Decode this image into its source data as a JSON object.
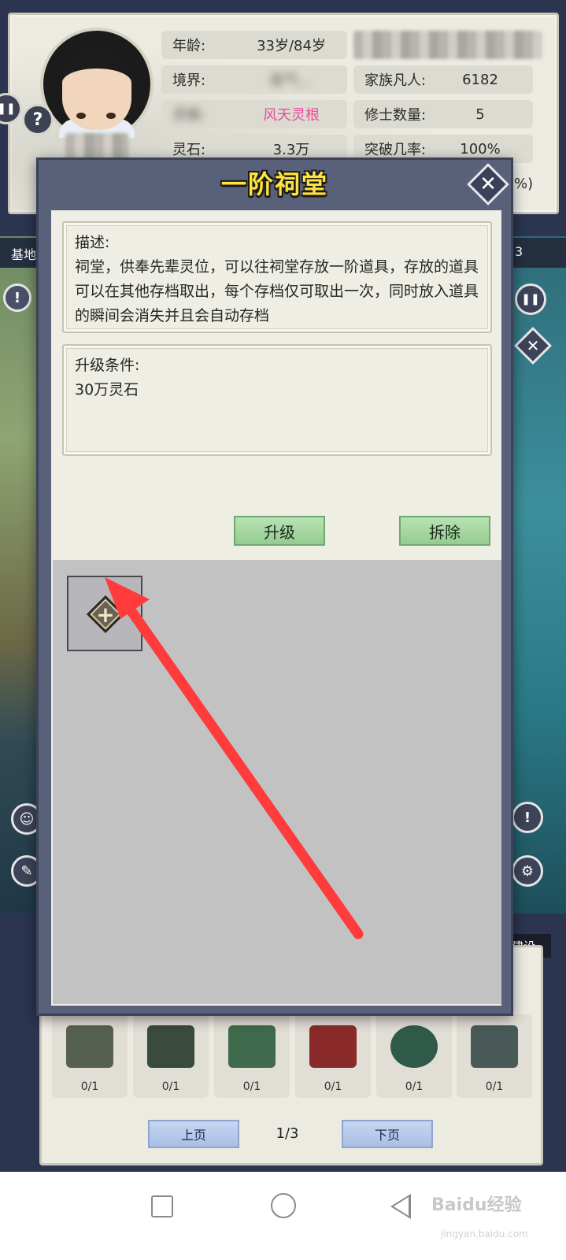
{
  "profile": {
    "stats": [
      {
        "label": "年龄:",
        "value": "33岁/84岁"
      },
      {
        "label": "境界:",
        "value": "炼气…"
      },
      {
        "label": "灵根:",
        "value": "风天灵根"
      },
      {
        "label": "灵石:",
        "value": "3.3万"
      }
    ],
    "family": [
      {
        "label": "家族凡人:",
        "value": "6182"
      },
      {
        "label": "修士数量:",
        "value": "5"
      },
      {
        "label": "突破几率:",
        "value": "100%"
      }
    ],
    "clipped_value": "%)",
    "help_glyph": "?"
  },
  "background": {
    "left_label": "基地",
    "right_label": "3",
    "build_tab": "建设"
  },
  "dialog": {
    "title": "一阶祠堂",
    "close_glyph": "✕",
    "description_title": "描述:",
    "description_text": "祠堂，供奉先辈灵位，可以往祠堂存放一阶道具，存放的道具可以在其他存档取出，每个存档仅可取出一次，同时放入道具的瞬间会消失并且会自动存档",
    "upgrade_title": "升级条件:",
    "upgrade_text": "30万灵石",
    "upgrade_button": "升级",
    "demolish_button": "拆除",
    "add_glyph": "+"
  },
  "buildings": {
    "counts": [
      "0/1",
      "0/1",
      "0/1",
      "0/1",
      "0/1",
      "0/1"
    ],
    "prev_page": "上页",
    "page_indicator": "1/3",
    "next_page": "下页"
  },
  "watermark": {
    "main": "Baidu经验",
    "sub": "jingyan.baidu.com"
  },
  "colors": {
    "title_yellow": "#ffe23a",
    "arrow_red": "#ff3b3b",
    "link_pink": "#e84c9a",
    "button_green": "#95cc91"
  }
}
